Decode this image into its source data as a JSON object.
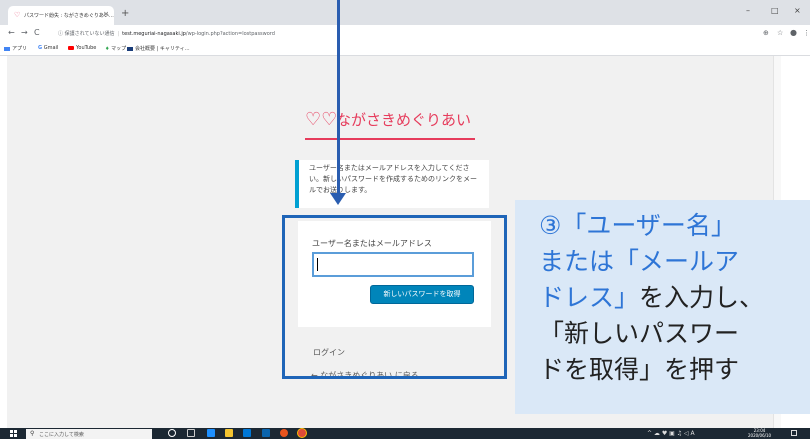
{
  "browser": {
    "tab_title": "パスワード紛失 : ながさきめぐりあい…",
    "tab_close": "×",
    "new_tab": "+",
    "window_min": "–",
    "window_max": "□",
    "window_close": "×",
    "security_label": "保護されていない通信",
    "url_domain": "test.meguriai-nagasaki.jp",
    "url_path": "/wp-login.php?action=lostpassword",
    "bookmarks": [
      "アプリ",
      "Gmail",
      "YouTube",
      "マップ",
      "会社概要 | キャリティ…"
    ]
  },
  "page": {
    "site_name": "ながさきめぐりあい",
    "message": "ユーザー名またはメールアドレスを入力してください。新しいパスワードを作成するためのリンクをメールでお送りします。",
    "form_label": "ユーザー名またはメールアドレス",
    "input_value": "",
    "submit_label": "新しいパスワードを取得",
    "login_link": "ログイン",
    "back_link": "← ながさきめぐりあい に戻る"
  },
  "annotation": {
    "line1": "③「ユーザー名」",
    "line2": "または「メールア",
    "line3_blue": "ドレス」",
    "line3_dark": "を入力し、",
    "line4": "「新しいパスワー",
    "line5": "ドを取得」を押す"
  },
  "taskbar": {
    "search_placeholder": "ここに入力して検索",
    "tray_lang": "A",
    "clock_time": "23:04",
    "clock_date": "2020/06/10"
  },
  "colors": {
    "accent_blue": "#0085ba",
    "logo_red": "#e63c5c",
    "annotation_blue": "#2e75d6",
    "highlight_border": "#1f65b8",
    "callout_bg": "#dae8f7"
  }
}
